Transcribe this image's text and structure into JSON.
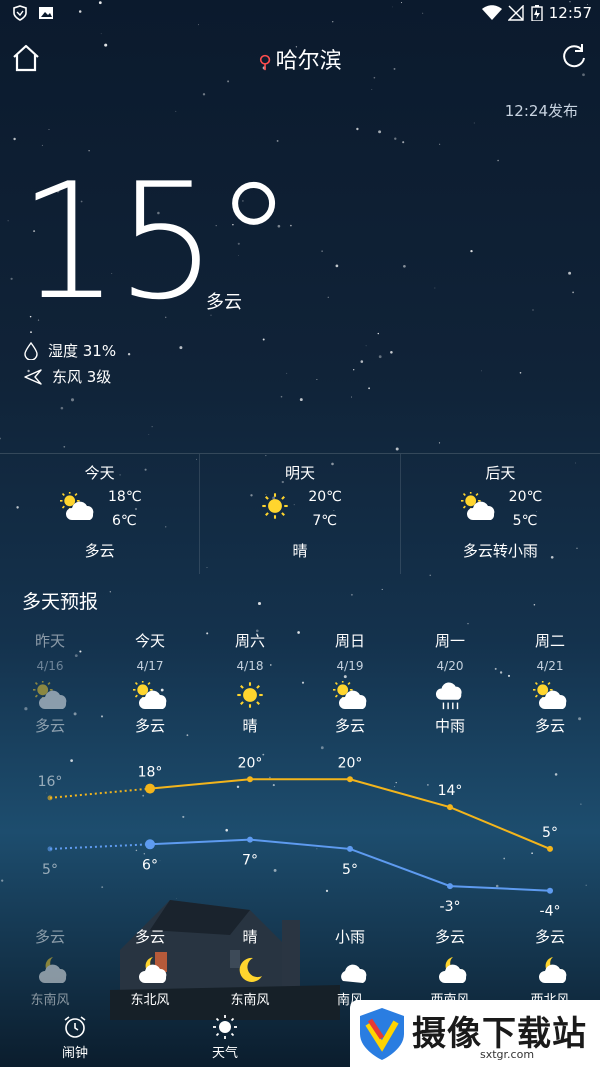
{
  "status_bar": {
    "time": "12:57"
  },
  "header": {
    "city": "哈尔滨",
    "published": "12:24发布"
  },
  "current": {
    "temperature": "15°",
    "condition": "多云",
    "humidity": "湿度 31%",
    "wind": "东风 3级"
  },
  "three_day": [
    {
      "name": "今天",
      "high": "18℃",
      "low": "6℃",
      "condition": "多云",
      "icon": "partly-cloudy-icon"
    },
    {
      "name": "明天",
      "high": "20℃",
      "low": "7℃",
      "condition": "晴",
      "icon": "sun-icon"
    },
    {
      "name": "后天",
      "high": "20℃",
      "low": "5℃",
      "condition": "多云转小雨",
      "icon": "partly-cloudy-icon"
    }
  ],
  "forecast": {
    "title": "多天预报",
    "days": [
      {
        "week": "昨天",
        "date": "4/16",
        "day_condition": "多云",
        "high": "16°",
        "low": "5°",
        "night_condition": "多云",
        "wind": "东南风",
        "day_icon": "partly-cloudy-icon",
        "night_icon": "moon-cloud-icon"
      },
      {
        "week": "今天",
        "date": "4/17",
        "day_condition": "多云",
        "high": "18°",
        "low": "6°",
        "night_condition": "多云",
        "wind": "东北风",
        "day_icon": "partly-cloudy-icon",
        "night_icon": "moon-cloud-icon"
      },
      {
        "week": "周六",
        "date": "4/18",
        "day_condition": "晴",
        "high": "20°",
        "low": "7°",
        "night_condition": "晴",
        "wind": "东南风",
        "day_icon": "sun-icon",
        "night_icon": "moon-icon"
      },
      {
        "week": "周日",
        "date": "4/19",
        "day_condition": "多云",
        "high": "20°",
        "low": "5°",
        "night_condition": "小雨",
        "wind": "南风",
        "day_icon": "partly-cloudy-icon",
        "night_icon": "cloud-icon"
      },
      {
        "week": "周一",
        "date": "4/20",
        "day_condition": "中雨",
        "high": "14°",
        "low": "-3°",
        "night_condition": "多云",
        "wind": "西南风",
        "day_icon": "rain-icon",
        "night_icon": "moon-cloud-icon"
      },
      {
        "week": "周二",
        "date": "4/21",
        "day_condition": "多云",
        "high": "5°",
        "low": "-4°",
        "night_condition": "多云",
        "wind": "西北风",
        "day_icon": "partly-cloudy-icon",
        "night_icon": "moon-cloud-icon"
      }
    ]
  },
  "chart_data": {
    "type": "line",
    "categories": [
      "4/16",
      "4/17",
      "4/18",
      "4/19",
      "4/20",
      "4/21"
    ],
    "series": [
      {
        "values": [
          16,
          18,
          20,
          20,
          14,
          5
        ],
        "color": "#f3b51c"
      },
      {
        "values": [
          5,
          6,
          7,
          5,
          -3,
          -4
        ],
        "color": "#5e9bf0"
      }
    ],
    "ylim": [
      -6,
      22
    ]
  },
  "bottom_nav": {
    "alarm_label": "闹钟",
    "weather_label": "天气"
  },
  "watermark": {
    "text": "摄像下载站",
    "url": "sxtgr.com"
  },
  "colors": {
    "high_line": "#f3b51c",
    "low_line": "#5e9bf0",
    "pin": "#ff4d4d"
  }
}
